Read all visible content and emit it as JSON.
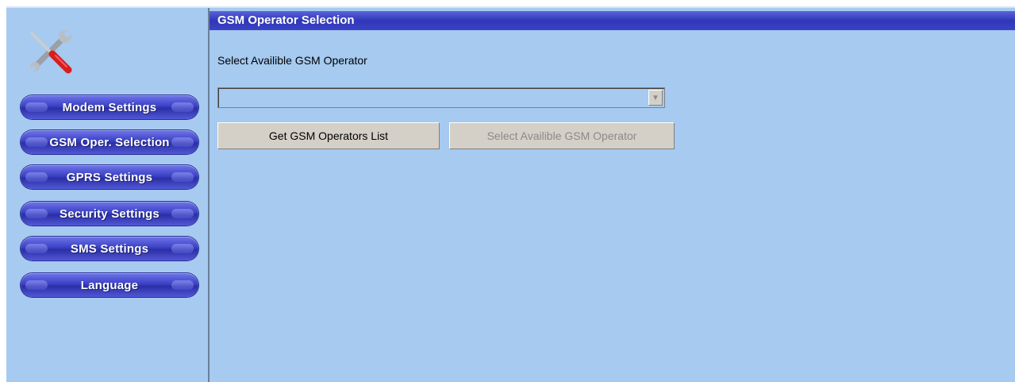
{
  "sidebar": {
    "logo_icon": "tools-icon",
    "items": [
      {
        "label": "Modem Settings"
      },
      {
        "label": "GSM Oper. Selection"
      },
      {
        "label": "GPRS Settings"
      },
      {
        "label": "Security Settings"
      },
      {
        "label": "SMS Settings"
      },
      {
        "label": "Language"
      }
    ]
  },
  "panel": {
    "title": "GSM Operator Selection",
    "label": "Select Availible GSM Operator",
    "combo": {
      "value": "",
      "arrow_icon": "chevron-down-icon"
    },
    "buttons": {
      "get": "Get GSM Operators List",
      "select": "Select Availible GSM Operator",
      "select_disabled": true
    }
  },
  "colors": {
    "background": "#a6caf0",
    "nav_button": "#3b41c5",
    "titlebar": "#2f37b8"
  }
}
